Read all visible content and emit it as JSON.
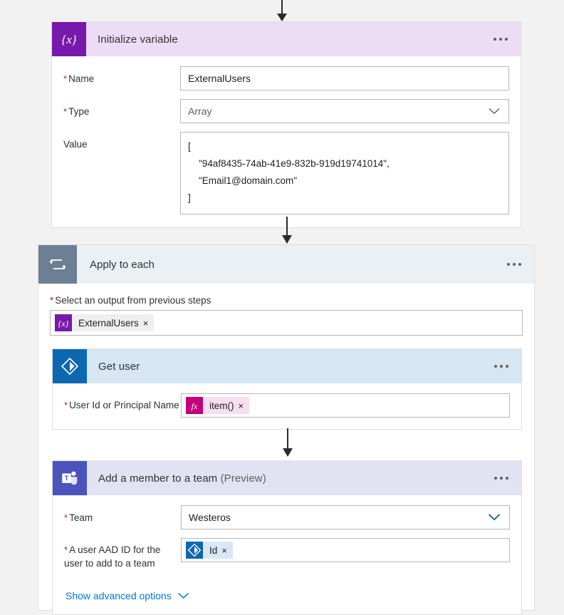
{
  "canvas": {
    "background": "#f2f2f2",
    "connector_color": "#2b2b2b"
  },
  "cards": [
    {
      "id": "initialize-variable",
      "title": "Initialize variable",
      "title_suffix": "",
      "icon": "variable-braces-icon",
      "icon_glyph": "{x}",
      "icon_color": "#7719aa",
      "header_color": "#eddcf5",
      "menu_label": "...",
      "fields": [
        {
          "kind": "text",
          "label": "Name",
          "required": true,
          "value": "ExternalUsers",
          "placeholder": "Enter variable name"
        },
        {
          "kind": "dropdown",
          "label": "Type",
          "required": true,
          "value": "Array",
          "chevron": "chevron-down-icon",
          "chevron_color": "#605e5c"
        },
        {
          "kind": "textarea",
          "label": "Value",
          "required": false,
          "lines": [
            "[",
            "    \"94af8435-74ab-41e9-832b-919d19741014\",",
            "    \"Email1@domain.com\"",
            "]"
          ]
        }
      ]
    },
    {
      "id": "apply-to-each",
      "title": "Apply to each",
      "icon": "loop-repeat-icon",
      "icon_color": "#6d7f94",
      "header_color": "#eaf0f4",
      "menu_label": "...",
      "output_label": "Select an output from previous steps",
      "output_required": true,
      "output_token": {
        "text": "ExternalUsers",
        "badge": "variable-braces-icon",
        "badge_glyph": "{x}",
        "badge_color": "#7719aa",
        "chip_color": "#efeff0",
        "remove_label": "×"
      }
    },
    {
      "id": "get-user",
      "title": "Get user",
      "title_suffix": "",
      "icon": "azure-ad-diamond-icon",
      "icon_color": "#0c68b1",
      "header_color": "#d6e6f2",
      "menu_label": "...",
      "fields": [
        {
          "kind": "token",
          "label": "User Id or Principal Name",
          "required": true,
          "token": {
            "text": "item()",
            "badge": "function-fx-icon",
            "badge_glyph": "fx",
            "badge_color": "#c3007a",
            "chip_color": "#f6dff0",
            "remove_label": "×"
          }
        }
      ]
    },
    {
      "id": "add-member-to-team",
      "title": "Add a member to a team",
      "title_suffix": "(Preview)",
      "icon": "microsoft-teams-icon",
      "icon_color": "#4b53bc",
      "header_color": "#e2e3f2",
      "menu_label": "...",
      "fields": [
        {
          "kind": "dropdown",
          "label": "Team",
          "required": true,
          "value": "Westeros",
          "chevron": "chevron-down-icon",
          "chevron_color": "#1f5fa8"
        },
        {
          "kind": "token",
          "label": "A user AAD ID for the user to add to a team",
          "required": true,
          "token": {
            "text": "Id",
            "badge": "azure-ad-diamond-icon",
            "badge_glyph": "",
            "badge_color": "#0c68b1",
            "chip_color": "#d9e8f7",
            "remove_label": "×"
          }
        }
      ],
      "advanced_link": {
        "label": "Show advanced options",
        "icon": "chevron-down-icon",
        "color": "#0078d4"
      }
    }
  ]
}
